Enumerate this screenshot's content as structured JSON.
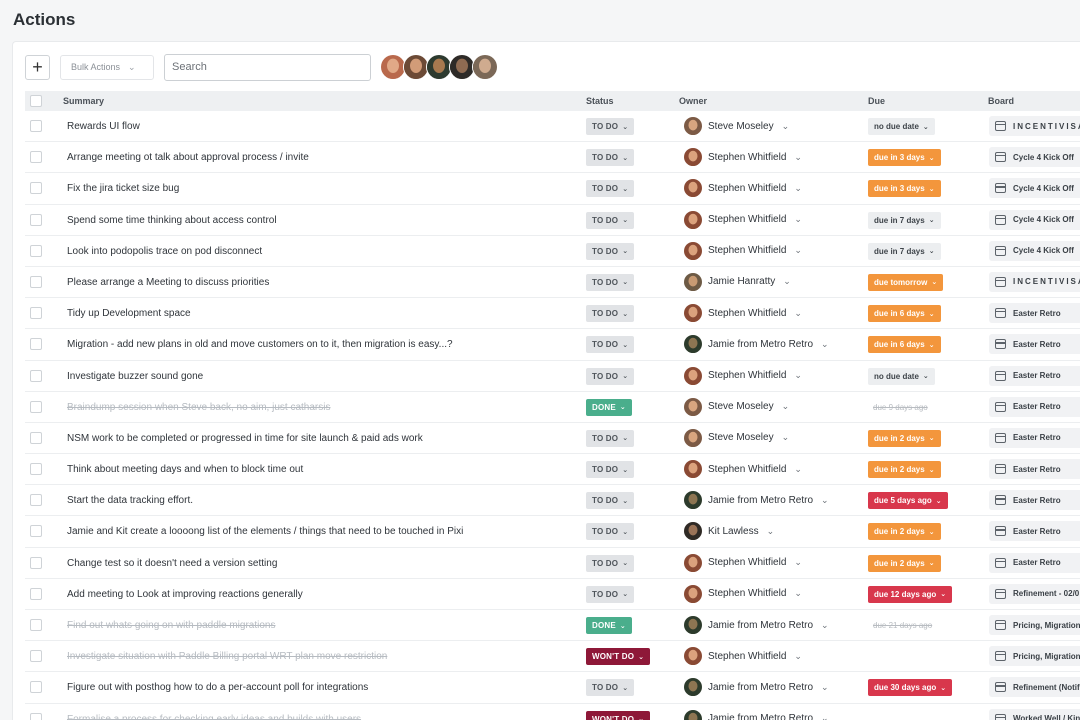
{
  "page": {
    "title": "Actions"
  },
  "toolbar": {
    "add_label": "+",
    "bulk_label": "Bulk Actions",
    "search_placeholder": "Search",
    "filter_avatars": [
      {
        "colors": [
          "#b9694c",
          "#e1a987"
        ]
      },
      {
        "colors": [
          "#6c4a36",
          "#d29c78"
        ]
      },
      {
        "colors": [
          "#2d3a2f",
          "#a7794f"
        ]
      },
      {
        "colors": [
          "#2e2b28",
          "#8f6b52"
        ]
      },
      {
        "colors": [
          "#7b6857",
          "#cfab8f"
        ]
      }
    ]
  },
  "columns": {
    "summary": "Summary",
    "status": "Status",
    "owner": "Owner",
    "due": "Due",
    "board": "Board"
  },
  "owners": {
    "steve": {
      "name": "Steve Moseley",
      "colors": [
        "#7c5a45",
        "#d8a57f"
      ]
    },
    "stephen": {
      "name": "Stephen Whitfield",
      "colors": [
        "#8a4a34",
        "#dba27d"
      ]
    },
    "jamie_h": {
      "name": "Jamie Hanratty",
      "colors": [
        "#6d5a45",
        "#c89a73"
      ]
    },
    "jamie_m": {
      "name": "Jamie from Metro Retro",
      "colors": [
        "#2d3b2c",
        "#8d7552"
      ]
    },
    "kit": {
      "name": "Kit Lawless",
      "colors": [
        "#2f2a25",
        "#9a7357"
      ]
    }
  },
  "rows": [
    {
      "summary": "Rewards UI flow",
      "status": "TO DO",
      "status_kind": "todo",
      "owner": "steve",
      "due": "no due date",
      "due_kind": "none",
      "board": "INCENTIVISA",
      "board_caps": true
    },
    {
      "summary": "Arrange meeting ot talk about approval process / invite",
      "status": "TO DO",
      "status_kind": "todo",
      "owner": "stephen",
      "due": "due in 3 days",
      "due_kind": "orange",
      "board": "Cycle 4 Kick Off"
    },
    {
      "summary": "Fix the jira ticket size bug",
      "status": "TO DO",
      "status_kind": "todo",
      "owner": "stephen",
      "due": "due in 3 days",
      "due_kind": "orange",
      "board": "Cycle 4 Kick Off"
    },
    {
      "summary": "Spend some time thinking about access control",
      "status": "TO DO",
      "status_kind": "todo",
      "owner": "stephen",
      "due": "due in 7 days",
      "due_kind": "none",
      "board": "Cycle 4 Kick Off"
    },
    {
      "summary": "Look into podopolis trace on pod disconnect",
      "status": "TO DO",
      "status_kind": "todo",
      "owner": "stephen",
      "due": "due in 7 days",
      "due_kind": "none",
      "board": "Cycle 4 Kick Off"
    },
    {
      "summary": "Please arrange a Meeting to discuss priorities",
      "status": "TO DO",
      "status_kind": "todo",
      "owner": "jamie_h",
      "due": "due tomorrow",
      "due_kind": "orange",
      "board": "INCENTIVISA",
      "board_caps": true
    },
    {
      "summary": "Tidy up Development space",
      "status": "TO DO",
      "status_kind": "todo",
      "owner": "stephen",
      "due": "due in 6 days",
      "due_kind": "orange",
      "board": "Easter Retro"
    },
    {
      "summary": "Migration - add new plans in old and move customers on to it, then migration is easy...?",
      "status": "TO DO",
      "status_kind": "todo",
      "owner": "jamie_m",
      "due": "due in 6 days",
      "due_kind": "orange",
      "board": "Easter Retro"
    },
    {
      "summary": "Investigate buzzer sound gone",
      "status": "TO DO",
      "status_kind": "todo",
      "owner": "stephen",
      "due": "no due date",
      "due_kind": "none",
      "board": "Easter Retro"
    },
    {
      "summary": "Braindump session when Steve back, no aim, just catharsis",
      "strike": true,
      "status": "DONE",
      "status_kind": "done",
      "owner": "steve",
      "due": "due 9 days ago",
      "due_kind": "strike",
      "board": "Easter Retro"
    },
    {
      "summary": "NSM work to be completed or progressed in time for site launch & paid ads work",
      "status": "TO DO",
      "status_kind": "todo",
      "owner": "steve",
      "due": "due in 2 days",
      "due_kind": "orange",
      "board": "Easter Retro"
    },
    {
      "summary": "Think about meeting days and when to block time out",
      "status": "TO DO",
      "status_kind": "todo",
      "owner": "stephen",
      "due": "due in 2 days",
      "due_kind": "orange",
      "board": "Easter Retro"
    },
    {
      "summary": "Start the data tracking effort.",
      "status": "TO DO",
      "status_kind": "todo",
      "owner": "jamie_m",
      "due": "due 5 days ago",
      "due_kind": "red",
      "board": "Easter Retro"
    },
    {
      "summary": "Jamie and Kit create a loooong list of the elements / things that need to be touched in Pixi",
      "status": "TO DO",
      "status_kind": "todo",
      "owner": "kit",
      "due": "due in 2 days",
      "due_kind": "orange",
      "board": "Easter Retro"
    },
    {
      "summary": "Change test so it doesn't need a version setting",
      "status": "TO DO",
      "status_kind": "todo",
      "owner": "stephen",
      "due": "due in 2 days",
      "due_kind": "orange",
      "board": "Easter Retro"
    },
    {
      "summary": "Add meeting to Look at improving reactions generally",
      "status": "TO DO",
      "status_kind": "todo",
      "owner": "stephen",
      "due": "due 12 days ago",
      "due_kind": "red",
      "board": "Refinement - 02/0"
    },
    {
      "summary": "Find out whats going on with paddle migrations",
      "strike": true,
      "status": "DONE",
      "status_kind": "done",
      "owner": "jamie_m",
      "due": "due 21 days ago",
      "due_kind": "strike",
      "board": "Pricing, Migration"
    },
    {
      "summary": "Investigate situation with Paddle Billing portal WRT plan move restriction",
      "strike": true,
      "status": "WON'T DO",
      "status_kind": "wont",
      "owner": "stephen",
      "due": "",
      "due_kind": "blank",
      "board": "Pricing, Migration"
    },
    {
      "summary": "Figure out with posthog how to do a per-account poll for integrations",
      "status": "TO DO",
      "status_kind": "todo",
      "owner": "jamie_m",
      "due": "due 30 days ago",
      "due_kind": "red",
      "board": "Refinement (Notif"
    },
    {
      "summary": "Formalise a process for checking early ideas and builds with users",
      "strike": true,
      "status": "WON'T DO",
      "status_kind": "wont",
      "owner": "jamie_m",
      "due": "",
      "due_kind": "blank",
      "board": "Worked Well / Kin"
    }
  ]
}
